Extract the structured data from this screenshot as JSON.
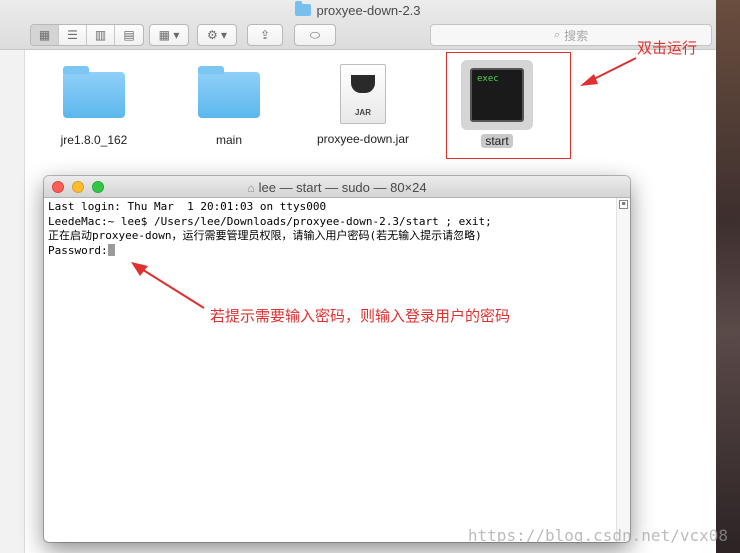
{
  "finder": {
    "title": "proxyee-down-2.3",
    "search_placeholder": "搜索",
    "items": [
      {
        "name": "jre1.8.0_162",
        "kind": "folder"
      },
      {
        "name": "main",
        "kind": "folder"
      },
      {
        "name": "proxyee-down.jar",
        "kind": "jar",
        "badge": "JAR"
      },
      {
        "name": "start",
        "kind": "exec",
        "badge": "exec"
      }
    ]
  },
  "annotations": {
    "double_click": "双击运行",
    "password_hint": "若提示需要输入密码，则输入登录用户的密码"
  },
  "terminal": {
    "title": "lee — start — sudo — 80×24",
    "lines": [
      "Last login: Thu Mar  1 20:01:03 on ttys000",
      "LeedeMac:~ lee$ /Users/lee/Downloads/proxyee-down-2.3/start ; exit;",
      "正在启动proxyee-down，运行需要管理员权限，请输入用户密码(若无输入提示请忽略)"
    ],
    "prompt": "Password:"
  },
  "watermark": "https://blog.csdn.net/vcx08",
  "colors": {
    "annotation": "#e03030",
    "folder": "#5cb7ec"
  }
}
